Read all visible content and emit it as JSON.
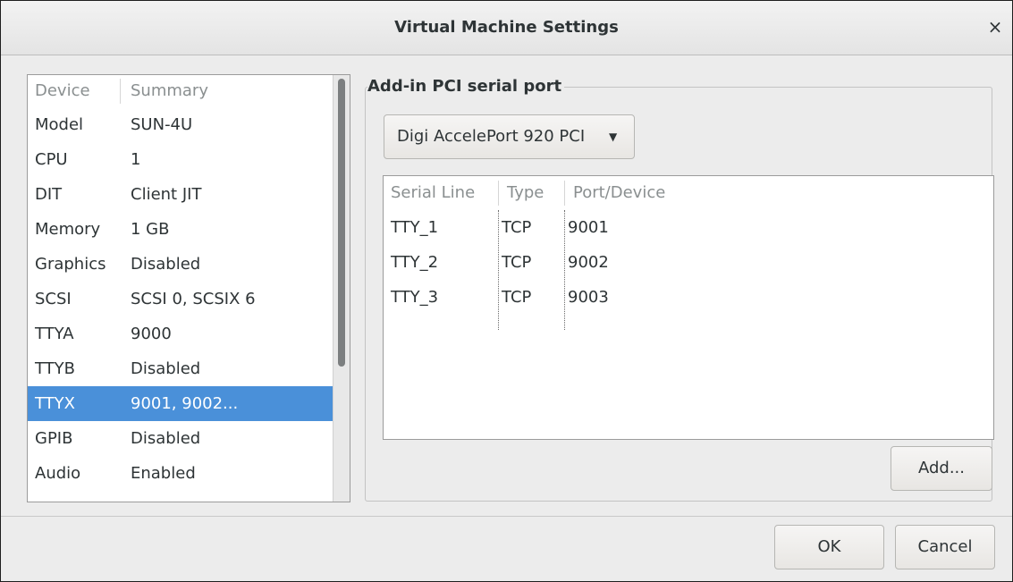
{
  "window": {
    "title": "Virtual Machine Settings",
    "close_glyph": "×"
  },
  "device_list": {
    "columns": [
      "Device",
      "Summary"
    ],
    "rows": [
      {
        "device": "Model",
        "summary": "SUN-4U"
      },
      {
        "device": "CPU",
        "summary": "1"
      },
      {
        "device": "DIT",
        "summary": "Client JIT"
      },
      {
        "device": "Memory",
        "summary": "1 GB"
      },
      {
        "device": "Graphics",
        "summary": "Disabled"
      },
      {
        "device": "SCSI",
        "summary": "SCSI 0, SCSIX 6"
      },
      {
        "device": "TTYA",
        "summary": "9000"
      },
      {
        "device": "TTYB",
        "summary": "Disabled"
      },
      {
        "device": "TTYX",
        "summary": "9001, 9002..."
      },
      {
        "device": "GPIB",
        "summary": "Disabled"
      },
      {
        "device": "Audio",
        "summary": "Enabled"
      }
    ],
    "selected_index": 8
  },
  "serial_group": {
    "label": "Add-in PCI serial port",
    "card_select": {
      "value": "Digi AccelePort 920 PCI",
      "arrow_icon": "▼"
    },
    "table": {
      "columns": [
        "Serial Line",
        "Type",
        "Port/Device"
      ],
      "rows": [
        {
          "line": "TTY_1",
          "type": "TCP",
          "port": "9001"
        },
        {
          "line": "TTY_2",
          "type": "TCP",
          "port": "9002"
        },
        {
          "line": "TTY_3",
          "type": "TCP",
          "port": "9003"
        }
      ]
    },
    "add_label": "Add..."
  },
  "footer": {
    "ok_label": "OK",
    "cancel_label": "Cancel"
  },
  "colors": {
    "selection": "#4a90d9",
    "background": "#ececec"
  }
}
